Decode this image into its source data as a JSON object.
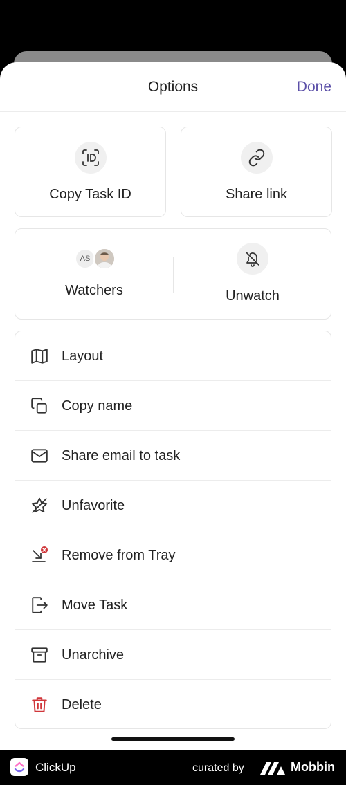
{
  "header": {
    "title": "Options",
    "done_label": "Done"
  },
  "quick_actions": [
    {
      "label": "Copy Task ID",
      "icon": "id-badge-icon"
    },
    {
      "label": "Share link",
      "icon": "link-icon"
    }
  ],
  "watch": {
    "watchers_label": "Watchers",
    "watcher_initials": "AS",
    "unwatch_label": "Unwatch"
  },
  "menu": [
    {
      "label": "Layout",
      "icon": "layout-map-icon"
    },
    {
      "label": "Copy name",
      "icon": "copy-icon"
    },
    {
      "label": "Share email to task",
      "icon": "email-icon"
    },
    {
      "label": "Unfavorite",
      "icon": "unfavorite-star-icon"
    },
    {
      "label": "Remove from Tray",
      "icon": "remove-tray-icon"
    },
    {
      "label": "Move Task",
      "icon": "move-task-icon"
    },
    {
      "label": "Unarchive",
      "icon": "unarchive-icon"
    },
    {
      "label": "Delete",
      "icon": "trash-icon",
      "color": "#d0363a"
    }
  ],
  "footer": {
    "app_name": "ClickUp",
    "curated_by": "curated by",
    "brand": "Mobbin"
  },
  "colors": {
    "accent": "#5b4fa8",
    "danger": "#d0363a"
  }
}
